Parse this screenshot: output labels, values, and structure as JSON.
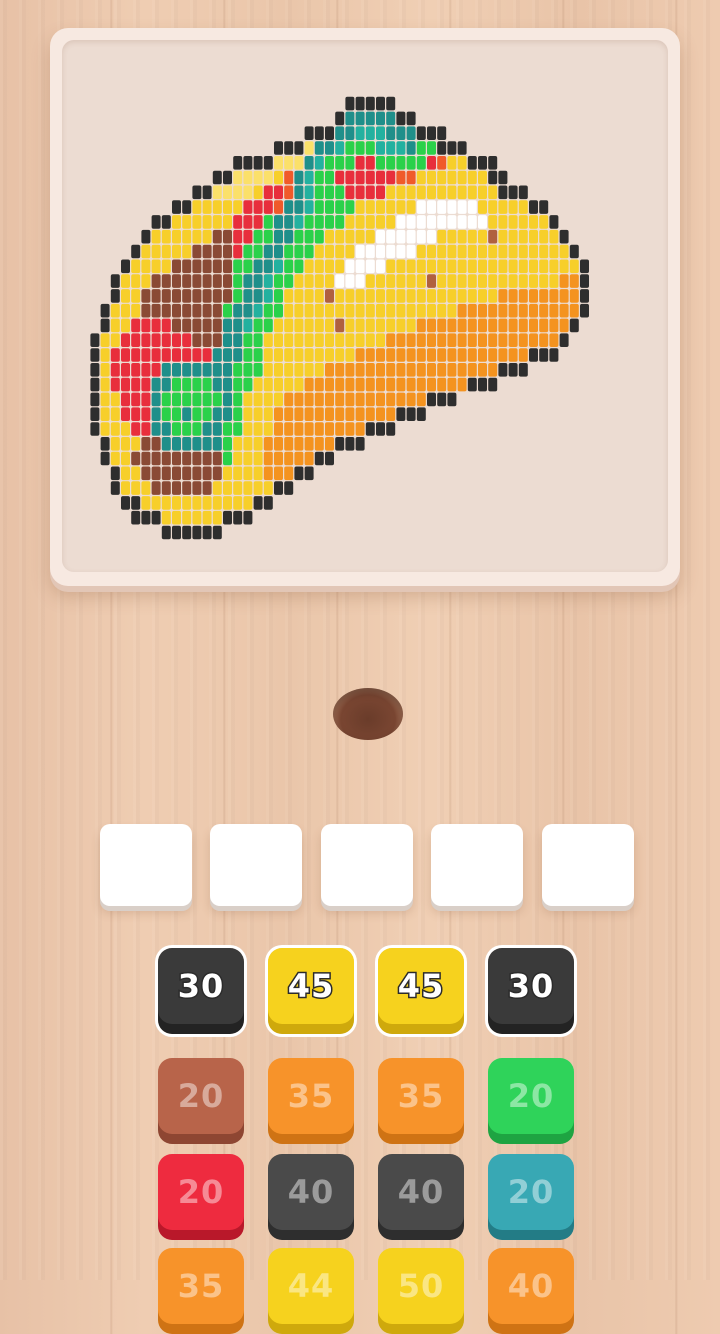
{
  "board": {
    "palette": {
      "K": "#2e2e2e",
      "Y": "#f7cf2a",
      "y": "#fbe06a",
      "O": "#f4931f",
      "o": "#f7ae3a",
      "B": "#8a4a35",
      "b": "#b0603f",
      "R": "#e82e3c",
      "r": "#f05a2a",
      "G": "#2ad14a",
      "T": "#1f8f8a",
      "t": "#23b19f",
      "W": "#ffffff"
    }
  },
  "slots": [
    {
      "id": 1,
      "state": "empty"
    },
    {
      "id": 2,
      "state": "empty"
    },
    {
      "id": 3,
      "state": "empty"
    },
    {
      "id": 4,
      "state": "empty"
    },
    {
      "id": 5,
      "state": "empty"
    }
  ],
  "rows": [
    [
      {
        "value": "30",
        "color": "#3a3a3a",
        "side": "#232323",
        "active": true
      },
      {
        "value": "45",
        "color": "#f6d21e",
        "side": "#cfa90c",
        "active": true
      },
      {
        "value": "45",
        "color": "#f6d21e",
        "side": "#cfa90c",
        "active": true
      },
      {
        "value": "30",
        "color": "#3a3a3a",
        "side": "#232323",
        "active": true
      }
    ],
    [
      {
        "value": "20",
        "color": "#b8644a",
        "side": "#8e4632",
        "active": false
      },
      {
        "value": "35",
        "color": "#f7932a",
        "side": "#cf7314",
        "active": false
      },
      {
        "value": "35",
        "color": "#f7932a",
        "side": "#cf7314",
        "active": false
      },
      {
        "value": "20",
        "color": "#2fd35a",
        "side": "#1ea442",
        "active": false
      }
    ],
    [
      {
        "value": "20",
        "color": "#ee2b3f",
        "side": "#b9182a",
        "active": false
      },
      {
        "value": "40",
        "color": "#4a4a4a",
        "side": "#2e2e2e",
        "active": false
      },
      {
        "value": "40",
        "color": "#4a4a4a",
        "side": "#2e2e2e",
        "active": false
      },
      {
        "value": "20",
        "color": "#38a8b4",
        "side": "#237c86",
        "active": false
      }
    ],
    [
      {
        "value": "35",
        "color": "#f7932a",
        "side": "#cf7314",
        "active": false
      },
      {
        "value": "44",
        "color": "#f6d21e",
        "side": "#cfa90c",
        "active": false
      },
      {
        "value": "50",
        "color": "#f6d21e",
        "side": "#cfa90c",
        "active": false
      },
      {
        "value": "40",
        "color": "#f7932a",
        "side": "#cf7314",
        "active": false
      }
    ]
  ]
}
